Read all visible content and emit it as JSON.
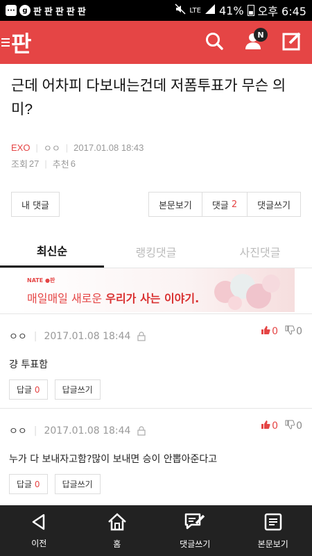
{
  "statusbar": {
    "icons": [
      "chat-icon",
      "g-icon",
      "pan-icon",
      "pan-icon",
      "pan-icon",
      "pan-icon",
      "pan-icon"
    ],
    "network": "LTE",
    "battery": "41%",
    "clock": "오후 6:45"
  },
  "appbar": {
    "logo": "판",
    "notification_badge": "N"
  },
  "post": {
    "title": "근데 어차피 다보내는건데 저폼투표가 무슨 의미?",
    "category": "EXO",
    "author": "ㅇㅇ",
    "date": "2017.01.08 18:43",
    "views_label": "조회",
    "views": "27",
    "likes_label": "추천",
    "likes": "6"
  },
  "actions": {
    "my_comments": "내 댓글",
    "view_post": "본문보기",
    "comments_label": "댓글",
    "comments_count": "2",
    "write_comment": "댓글쓰기"
  },
  "tabs": [
    "최신순",
    "랭킹댓글",
    "사진댓글"
  ],
  "banner": {
    "brand": "NATE ●판",
    "text_prefix": "매일매일 새로운 ",
    "text_emph": "우리가 사는 이야기."
  },
  "comments": [
    {
      "author": "ㅇㅇ",
      "date": "2017.01.08 18:44",
      "text": "걍 투표함",
      "up": "0",
      "down": "0",
      "reply_label": "답글",
      "reply_count": "0",
      "write_reply": "답글쓰기"
    },
    {
      "author": "ㅇㅇ",
      "date": "2017.01.08 18:44",
      "text": "누가 다 보내자고함?많이 보내면 승이 안뽑아준다고",
      "up": "0",
      "down": "0",
      "reply_label": "답글",
      "reply_count": "0",
      "write_reply": "답글쓰기"
    }
  ],
  "bottomnav": {
    "back": "이전",
    "home": "홈",
    "write_comment": "댓글쓰기",
    "view_post": "본문보기"
  },
  "colors": {
    "brand": "#e54545",
    "nav_bg": "#222222"
  }
}
